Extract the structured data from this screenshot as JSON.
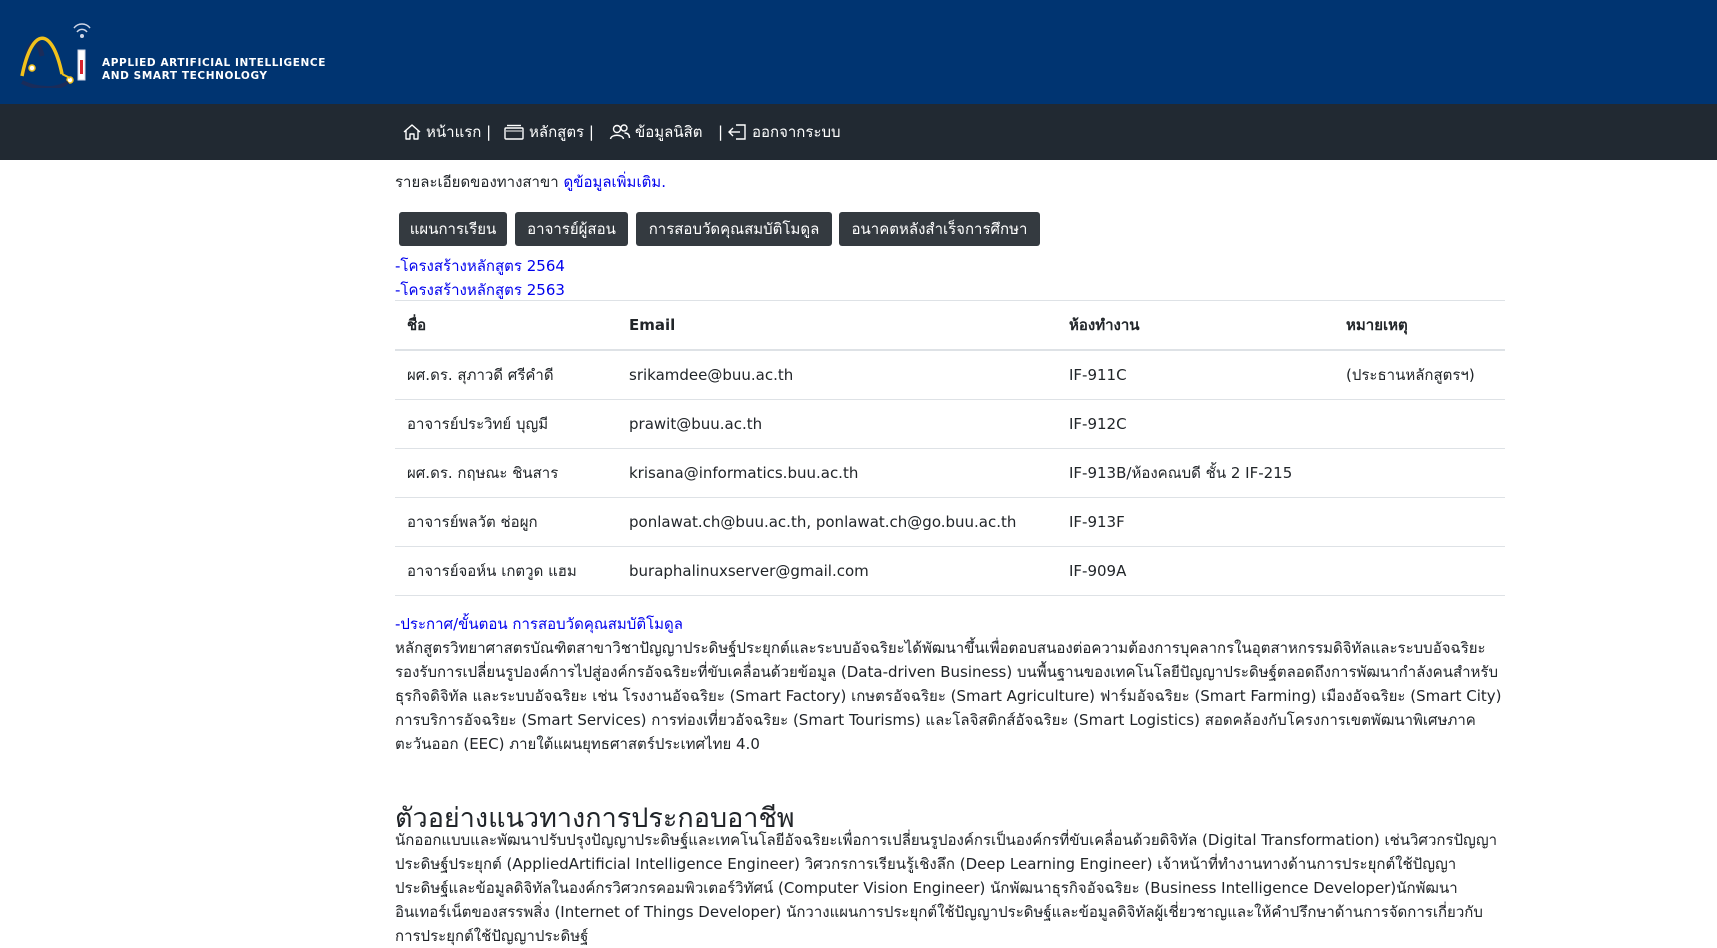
{
  "header": {
    "logo_line1": "APPLIED ARTIFICIAL INTELLIGENCE",
    "logo_line2": "AND SMART TECHNOLOGY",
    "logo_icon": "ai-logo-icon",
    "background": "#003471"
  },
  "nav": {
    "background": "#212932",
    "items": [
      {
        "label": "หน้าแรก |",
        "icon": "home-icon"
      },
      {
        "label": "หลักสูตร |",
        "icon": "book-icon"
      },
      {
        "label": "ข้อมูลนิสิต",
        "icon": "users-icon"
      },
      {
        "label": "|",
        "icon": ""
      },
      {
        "label": "ออกจากระบบ",
        "icon": "logout-icon"
      }
    ]
  },
  "main": {
    "intro_text": "รายละเอียดของทางสาขา",
    "intro_link": "ดูข้อมูลเพิ่มเติม.",
    "tab_buttons": [
      "แผนการเรียน",
      "อาจารย์ผู้สอน",
      "การสอบวัดคุณสมบัติโมดูล",
      "อนาคตหลังสำเร็จการศึกษา"
    ],
    "curriculum_links": [
      "-โครงสร้างหลักสูตร 2564",
      "-โครงสร้างหลักสูตร 2563"
    ],
    "table": {
      "headers": [
        "ชื่อ",
        "Email",
        "ห้องทำงาน",
        "หมายเหตุ"
      ],
      "rows": [
        [
          "ผศ.ดร. สุภาวดี ศรีคำดี",
          "srikamdee@buu.ac.th",
          "IF-911C",
          "(ประธานหลักสูตรฯ)"
        ],
        [
          "อาจารย์ประวิทย์ บุญมี",
          "prawit@buu.ac.th",
          "IF-912C",
          ""
        ],
        [
          "ผศ.ดร. กฤษณะ ชินสาร",
          "krisana@informatics.buu.ac.th",
          "IF-913B/ห้องคณบดี ชั้น 2 IF-215",
          ""
        ],
        [
          "อาจารย์พลวัต ช่อผูก",
          "ponlawat.ch@buu.ac.th, ponlawat.ch@go.buu.ac.th",
          "IF-913F",
          ""
        ],
        [
          "อาจารย์จอห์น เกตวูด แฮม",
          "buraphalinuxserver@gmail.com",
          "IF-909A",
          ""
        ]
      ]
    },
    "announcement_link": "-ประกาศ/ขั้นตอน การสอบวัดคุณสมบัติโมดูล",
    "description": "หลักสูตรวิทยาศาสตรบัณฑิตสาขาวิชาปัญญาประดิษฐ์ประยุกต์และระบบอัจฉริยะได้พัฒนาขึ้นเพื่อตอบสนองต่อความต้องการบุคลากรในอุตสาหกรรมดิจิทัลและระบบอัจฉริยะ รองรับการเปลี่ยนรูปองค์การไปสู่องค์กรอัจฉริยะที่ขับเคลื่อนด้วยข้อมูล (Data-driven Business) บนพื้นฐานของเทคโนโลยีปัญญาประดิษฐ์ตลอดถึงการพัฒนากำลังคนสำหรับธุรกิจดิจิทัล และระบบอัจฉริยะ เช่น โรงงานอัจฉริยะ (Smart Factory) เกษตรอัจฉริยะ (Smart Agriculture) ฟาร์มอัจฉริยะ (Smart Farming) เมืองอัจฉริยะ (Smart City) การบริการอัจฉริยะ (Smart Services) การท่องเที่ยวอัจฉริยะ (Smart Tourisms) และโลจิสติกส์อัจฉริยะ (Smart Logistics) สอดคล้องกับโครงการเขตพัฒนาพิเศษภาคตะวันออก (EEC) ภายใต้แผนยุทธศาสตร์ประเทศไทย 4.0",
    "career_heading": "ตัวอย่างแนวทางการประกอบอาชีพ",
    "career_text": "นักออกแบบและพัฒนาปรับปรุงปัญญาประดิษฐ์และเทคโนโลยีอัจฉริยะเพื่อการเปลี่ยนรูปองค์กรเป็นองค์กรที่ขับเคลื่อนด้วยดิจิทัล (Digital Transformation) เช่นวิศวกรปัญญาประดิษฐ์ประยุกต์ (AppliedArtificial Intelligence Engineer) วิศวกรการเรียนรู้เชิงลึก (Deep Learning Engineer) เจ้าหน้าที่ทำงานทางด้านการประยุกต์ใช้ปัญญาประดิษฐ์และข้อมูลดิจิทัลในองค์กรวิศวกรคอมพิวเตอร์วิทัศน์ (Computer Vision Engineer) นักพัฒนาธุรกิจอัจฉริยะ (Business Intelligence Developer)นักพัฒนาอินเทอร์เน็ตของสรรพสิ่ง (Internet of Things Developer) นักวางแผนการประยุกต์ใช้ปัญญาประดิษฐ์และข้อมูลดิจิทัลผู้เชี่ยวชาญและให้คำปรึกษาด้านการจัดการเกี่ยวกับการประยุกต์ใช้ปัญญาประดิษฐ์"
  }
}
